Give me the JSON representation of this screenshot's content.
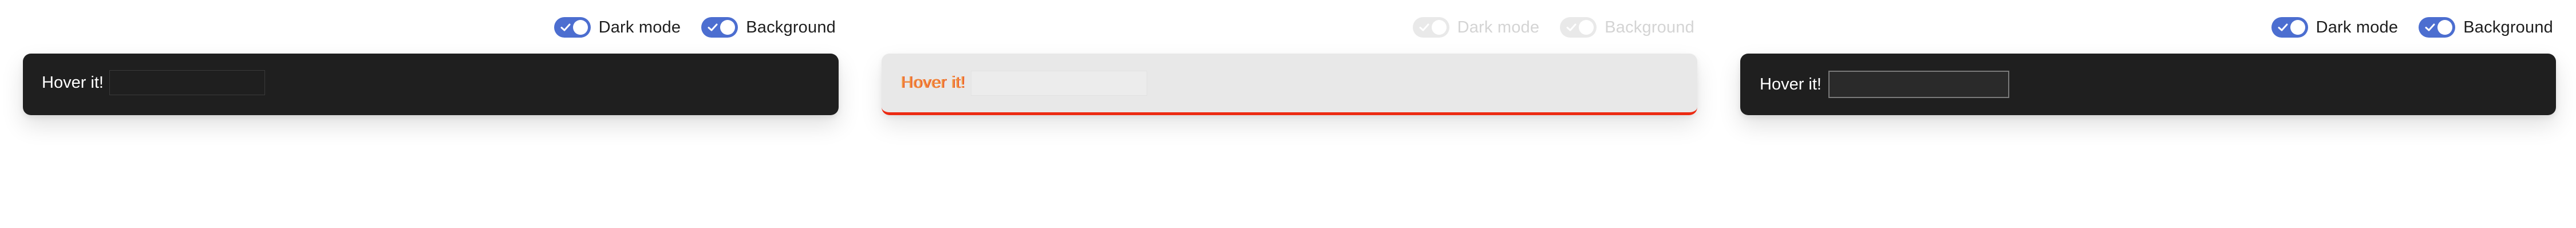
{
  "theme": {
    "accent": "#4c6ed0",
    "card_dark": "#1f1f1f",
    "card_light": "#e8e8e8",
    "underline": "#ec2a12"
  },
  "panels": [
    {
      "toggles": [
        {
          "label": "Dark mode",
          "checked": true,
          "icon": "check-icon"
        },
        {
          "label": "Background",
          "checked": true,
          "icon": "check-icon"
        }
      ],
      "card": {
        "label": "Hover it!",
        "input_value": "",
        "input_placeholder": ""
      }
    },
    {
      "toggles": [
        {
          "label": "Dark mode",
          "checked": true,
          "icon": "check-icon"
        },
        {
          "label": "Background",
          "checked": true,
          "icon": "check-icon"
        }
      ],
      "card": {
        "label": "Hover it!",
        "input_value": "",
        "input_placeholder": ""
      }
    },
    {
      "toggles": [
        {
          "label": "Dark mode",
          "checked": true,
          "icon": "check-icon"
        },
        {
          "label": "Background",
          "checked": true,
          "icon": "check-icon"
        }
      ],
      "card": {
        "label": "Hover it!",
        "input_value": "",
        "input_placeholder": ""
      }
    }
  ]
}
